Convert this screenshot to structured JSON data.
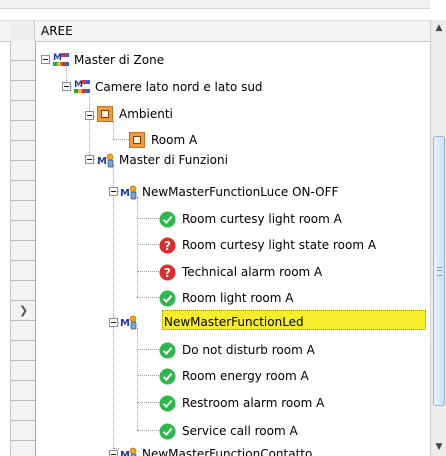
{
  "header": {
    "title": "AREE"
  },
  "colors": {
    "selection": "#f6ee2a",
    "ok": "#2db84b",
    "error": "#e02b2b",
    "room_orange": "#f39a37"
  },
  "tree": {
    "nodes": [
      {
        "label": "Master di Zone",
        "icon": "master-zone-icon",
        "expanded": true
      },
      {
        "label": "Camere lato nord e lato sud",
        "icon": "master-zone-icon",
        "expanded": true
      },
      {
        "label": "Ambienti",
        "icon": "room-folder-icon",
        "expanded": true
      },
      {
        "label": "Room A",
        "icon": "room-icon"
      },
      {
        "label": "Master di Funzioni",
        "icon": "master-function-icon",
        "expanded": true
      },
      {
        "label": "NewMasterFunctionLuce ON-OFF",
        "icon": "master-function-icon",
        "expanded": true
      },
      {
        "label": "Room curtesy light room A",
        "icon": "status-ok-icon"
      },
      {
        "label": "Room curtesy light state room A",
        "icon": "status-unknown-icon"
      },
      {
        "label": "Technical alarm room A",
        "icon": "status-unknown-icon"
      },
      {
        "label": "Room light room A",
        "icon": "status-ok-icon"
      },
      {
        "label": "NewMasterFunctionLed",
        "icon": "master-function-icon",
        "expanded": true,
        "selected": true
      },
      {
        "label": "Do not disturb room A",
        "icon": "status-ok-icon"
      },
      {
        "label": "Room energy room A",
        "icon": "status-ok-icon"
      },
      {
        "label": "Restroom alarm room A",
        "icon": "status-ok-icon"
      },
      {
        "label": "Service call room A",
        "icon": "status-ok-icon"
      },
      {
        "label": "NewMasterFunctionContatto",
        "icon": "master-function-icon",
        "expanded": true
      }
    ]
  }
}
